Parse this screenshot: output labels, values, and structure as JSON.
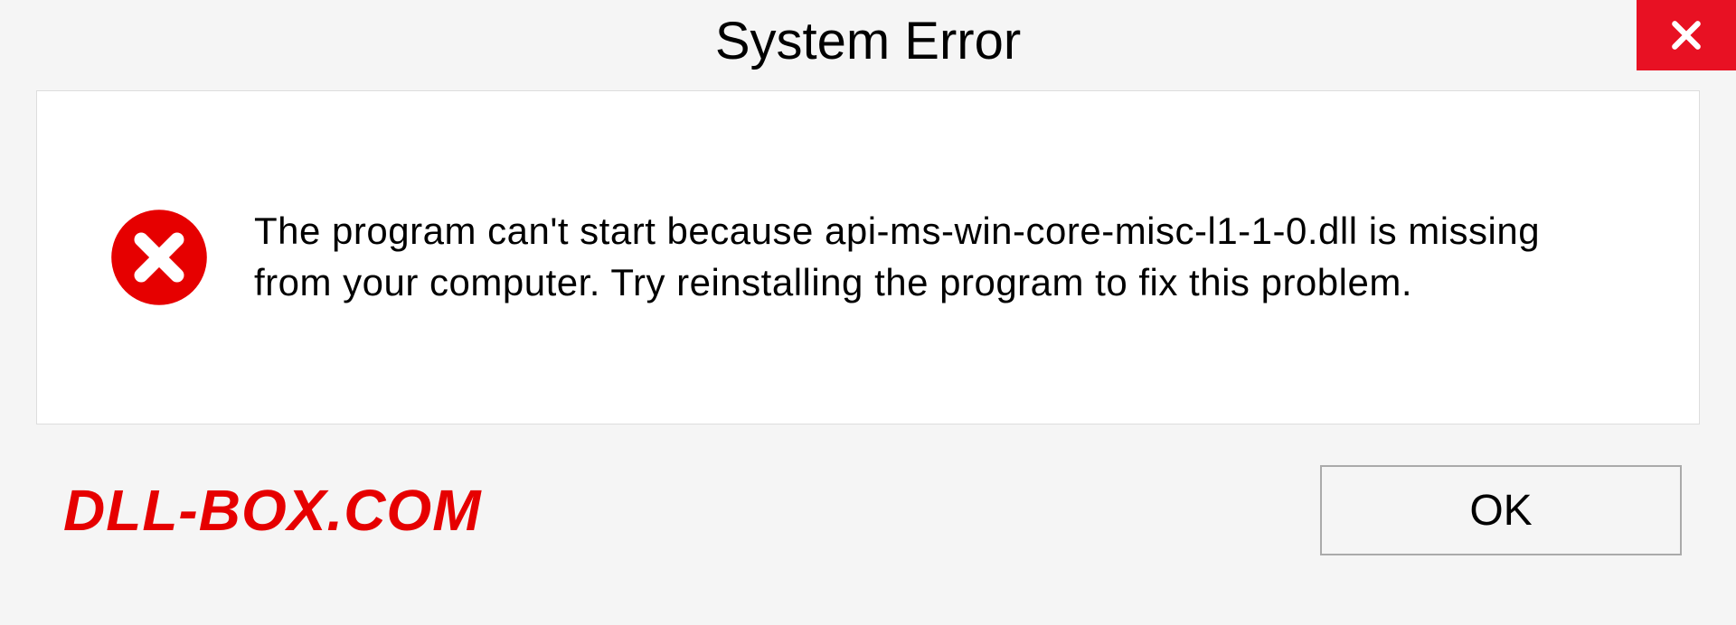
{
  "dialog": {
    "title": "System Error",
    "message": "The program can't start because api-ms-win-core-misc-l1-1-0.dll is missing from your computer. Try reinstalling the program to fix this problem.",
    "ok_label": "OK"
  },
  "watermark": "DLL-BOX.COM",
  "colors": {
    "close_bg": "#e81123",
    "error_icon": "#e60000",
    "watermark": "#e60000"
  }
}
